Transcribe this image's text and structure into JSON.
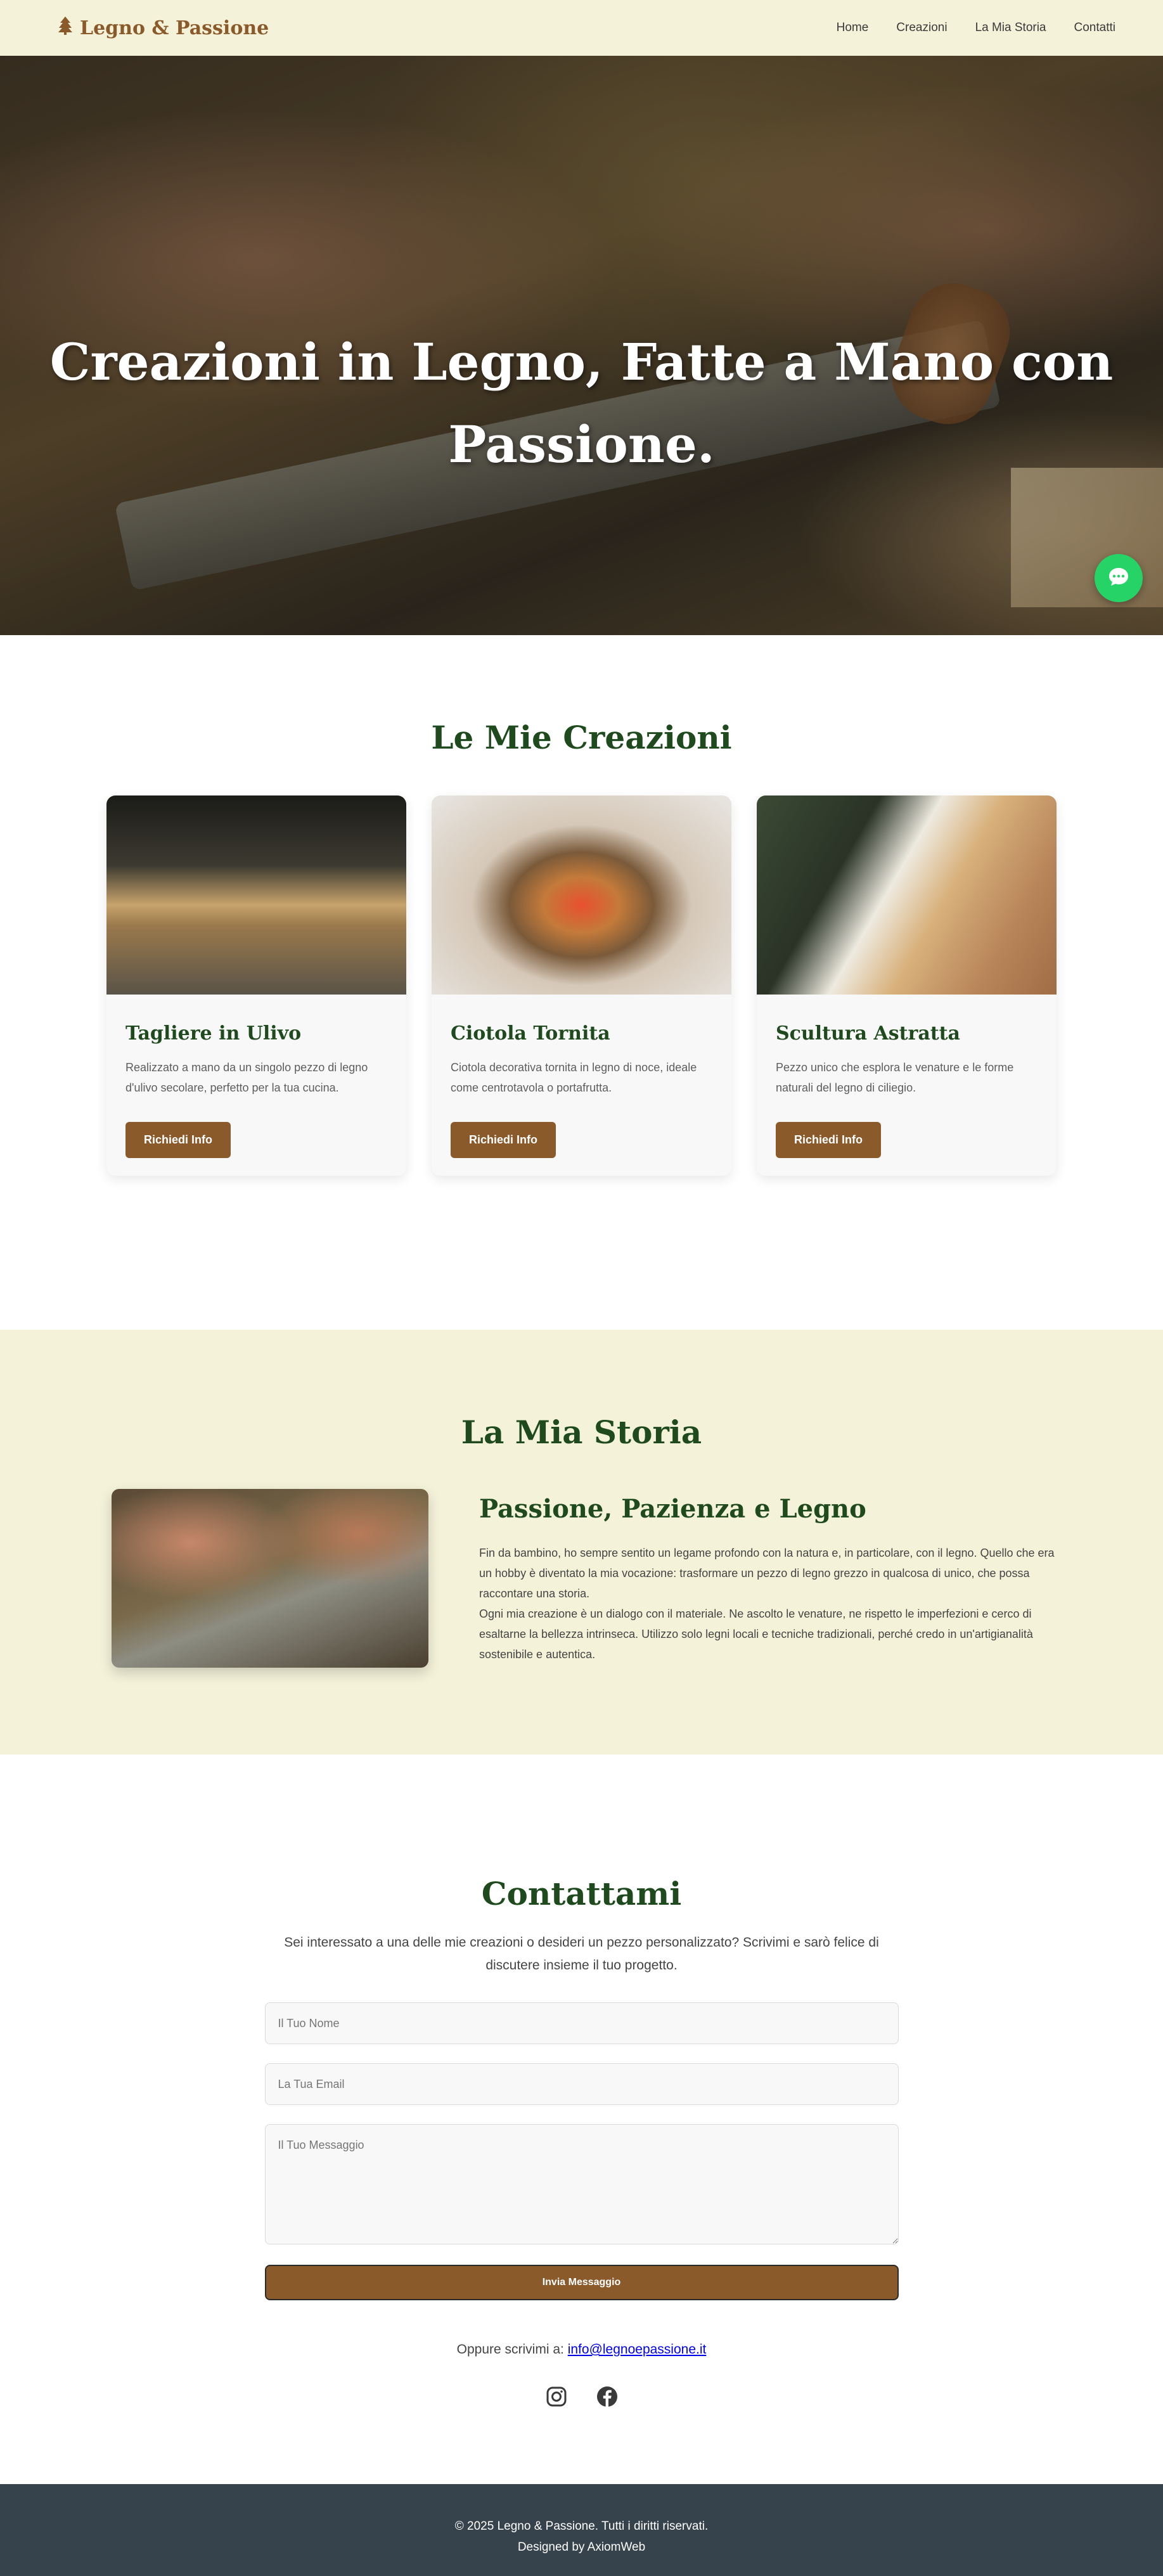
{
  "nav": {
    "brand": "Legno & Passione",
    "links": [
      "Home",
      "Creazioni",
      "La Mia Storia",
      "Contatti"
    ]
  },
  "hero": {
    "title_line1": "Creazioni in Legno, Fatte a Mano con",
    "title_line2": "Passione."
  },
  "creations": {
    "title": "Le Mie Creazioni",
    "cards": [
      {
        "title": "Tagliere in Ulivo",
        "desc": "Realizzato a mano da un singolo pezzo di legno d'ulivo secolare, perfetto per la tua cucina.",
        "button": "Richiedi Info"
      },
      {
        "title": "Ciotola Tornita",
        "desc": "Ciotola decorativa tornita in legno di noce, ideale come centrotavola o portafrutta.",
        "button": "Richiedi Info"
      },
      {
        "title": "Scultura Astratta",
        "desc": "Pezzo unico che esplora le venature e le forme naturali del legno di ciliegio.",
        "button": "Richiedi Info"
      }
    ]
  },
  "story": {
    "title": "La Mia Storia",
    "heading": "Passione, Pazienza e Legno",
    "p1": "Fin da bambino, ho sempre sentito un legame profondo con la natura e, in particolare, con il legno. Quello che era un hobby è diventato la mia vocazione: trasformare un pezzo di legno grezzo in qualcosa di unico, che possa raccontare una storia.",
    "p2": "Ogni mia creazione è un dialogo con il materiale. Ne ascolto le venature, ne rispetto le imperfezioni e cerco di esaltarne la bellezza intrinseca. Utilizzo solo legni locali e tecniche tradizionali, perché credo in un'artigianalità sostenibile e autentica."
  },
  "contact": {
    "title": "Contattami",
    "subtitle": "Sei interessato a una delle mie creazioni o desideri un pezzo personalizzato? Scrivimi e sarò felice di discutere insieme il tuo progetto.",
    "name_placeholder": "Il Tuo Nome",
    "email_placeholder": "La Tua Email",
    "message_placeholder": "Il Tuo Messaggio",
    "submit": "Invia Messaggio",
    "or_text": "Oppure scrivimi a:",
    "email": "info@legnoepassione.it",
    "social_icons": [
      "instagram-icon",
      "facebook-icon"
    ]
  },
  "footer": {
    "copyright": "© 2025 Legno & Passione. Tutti i diritti riservati.",
    "credit": "Designed by AxiomWeb"
  },
  "colors": {
    "brown": "#8a5a2b",
    "green": "#1e4a1e",
    "cream": "#f4f2d8",
    "footer": "#36424c",
    "whatsapp": "#25d366"
  }
}
